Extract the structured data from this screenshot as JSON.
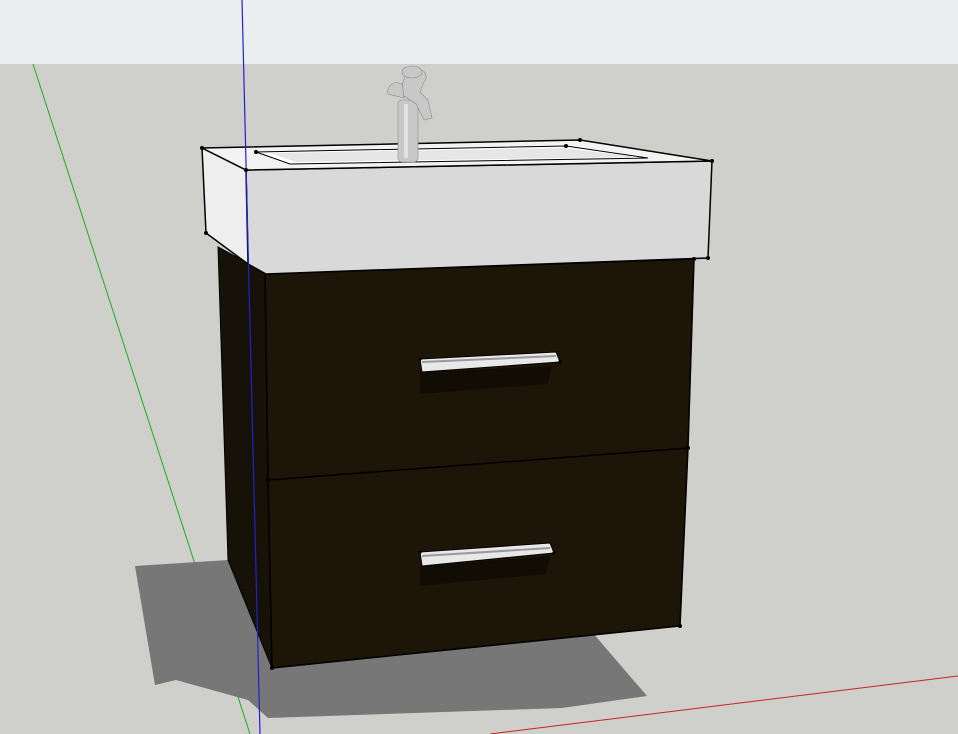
{
  "app": {
    "tool": "3d-modeling-viewport"
  },
  "scene": {
    "sky_color": "#ebeeee",
    "ground_color": "#cfcfcb",
    "shadow_color": "#777777",
    "axes": {
      "x_axis_color": "#cc2222",
      "y_axis_color": "#22aa22",
      "z_axis_color": "#2222cc"
    },
    "model": {
      "cabinet_color": "#1d1608",
      "cabinet_side_color": "#171207",
      "basin_top_color": "#f3f3f3",
      "basin_front_color": "#d9d9d9",
      "basin_side_color": "#eeeeee",
      "handle_color": "#e8e8e8",
      "faucet_color": "#c8c8c8",
      "drawer_count": 2
    }
  }
}
